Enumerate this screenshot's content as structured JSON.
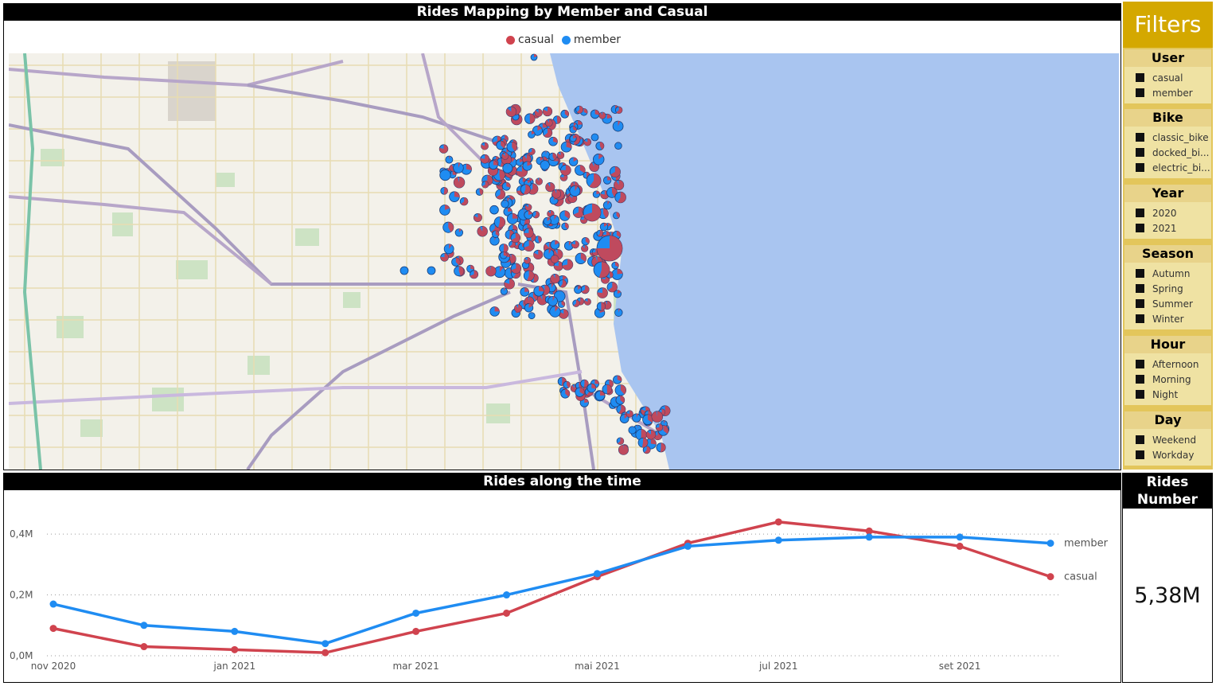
{
  "map_panel": {
    "title": "Rides Mapping by Member and Casual",
    "legend": [
      {
        "label": "casual",
        "color": "#d0434e"
      },
      {
        "label": "member",
        "color": "#1f8cf2"
      }
    ],
    "water_color": "#a9c5f0"
  },
  "time_panel": {
    "title": "Rides along the time"
  },
  "filters": {
    "title": "Filters",
    "groups": [
      {
        "title": "User",
        "items": [
          "casual",
          "member"
        ]
      },
      {
        "title": "Bike",
        "items": [
          "classic_bike",
          "docked_bi...",
          "electric_bi..."
        ]
      },
      {
        "title": "Year",
        "items": [
          "2020",
          "2021"
        ]
      },
      {
        "title": "Season",
        "items": [
          "Autumn",
          "Spring",
          "Summer",
          "Winter"
        ]
      },
      {
        "title": "Hour",
        "items": [
          "Afternoon",
          "Morning",
          "Night"
        ]
      },
      {
        "title": "Day",
        "items": [
          "Weekend",
          "Workday"
        ]
      }
    ]
  },
  "rides_card": {
    "title": "Rides Number",
    "value": "5,38M"
  },
  "chart_data": {
    "type": "line",
    "x": [
      "2020-11",
      "2020-12",
      "2021-01",
      "2021-02",
      "2021-03",
      "2021-04",
      "2021-05",
      "2021-06",
      "2021-07",
      "2021-08",
      "2021-09",
      "2021-10"
    ],
    "x_tick_labels": [
      "nov 2020",
      "jan 2021",
      "mar 2021",
      "mai 2021",
      "jul 2021",
      "set 2021"
    ],
    "y_tick_labels": [
      "0,0M",
      "0,2M",
      "0,4M"
    ],
    "ylim": [
      0,
      0.45
    ],
    "y_unit": "M",
    "grid": "horizontal dotted",
    "series": [
      {
        "name": "member",
        "color": "#1f8cf2",
        "values": [
          0.17,
          0.1,
          0.08,
          0.04,
          0.14,
          0.2,
          0.27,
          0.36,
          0.38,
          0.39,
          0.39,
          0.37
        ]
      },
      {
        "name": "casual",
        "color": "#d0434e",
        "values": [
          0.09,
          0.03,
          0.02,
          0.01,
          0.08,
          0.14,
          0.26,
          0.37,
          0.44,
          0.41,
          0.36,
          0.26
        ]
      }
    ]
  }
}
